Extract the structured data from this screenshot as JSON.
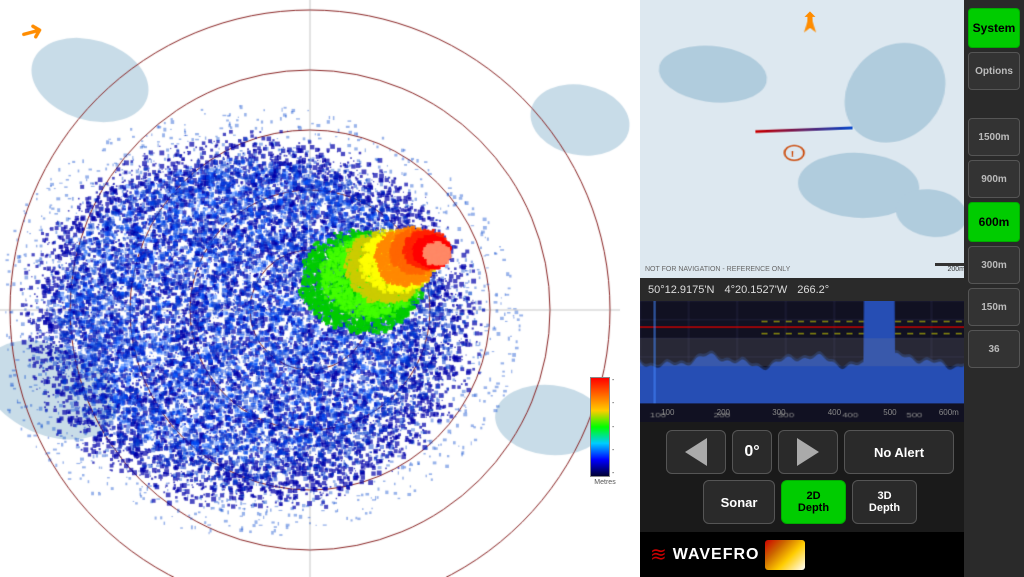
{
  "radar": {
    "wind_arrow": "→",
    "color_scale_labels": [
      "red",
      "orange",
      "yellow",
      "green",
      "cyan",
      "blue",
      "dark"
    ]
  },
  "chart": {
    "disclaimer": "NOT FOR NAVIGATION - REFERENCE ONLY",
    "scale_label": "200m",
    "compass_arrow": "↑"
  },
  "coords": {
    "lat": "50°12.9175'N",
    "lon": "4°20.1527'W",
    "bearing": "266.2°"
  },
  "sonar": {
    "x_labels": [
      "100",
      "200",
      "300",
      "400",
      "500",
      "600m"
    ]
  },
  "controls": {
    "angle_label": "0°",
    "alert_label": "No Alert",
    "sonar_label": "Sonar",
    "btn_2d_label": "2D\nDepth",
    "btn_3d_label": "3D\nDepth"
  },
  "logo": {
    "text": "WAVEFRO",
    "waves_symbol": "≋"
  },
  "sidebar": {
    "system_label": "System",
    "options_label": "Options",
    "range_labels": [
      "1500m",
      "900m",
      "600m",
      "300m",
      "150m",
      "36"
    ]
  }
}
